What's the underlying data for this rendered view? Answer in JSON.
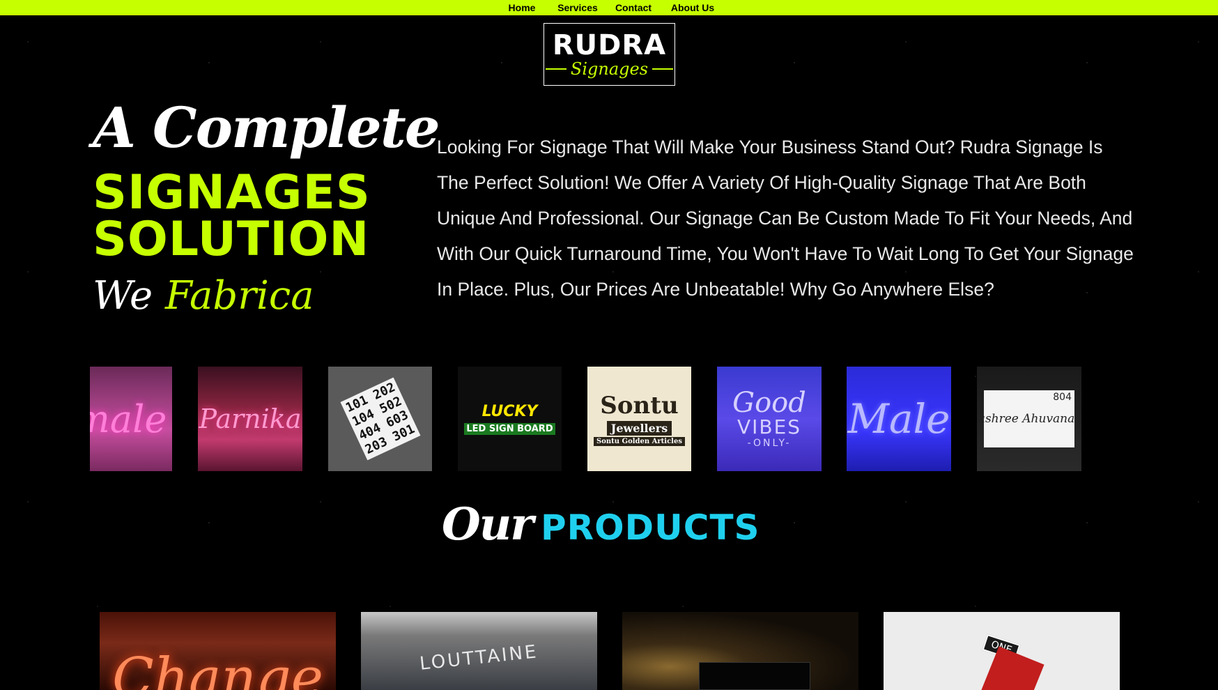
{
  "nav": {
    "home": "Home",
    "services": "Services",
    "contact": "Contact",
    "about": "About Us"
  },
  "logo": {
    "title": "RUDRA",
    "subtitle": "Signages"
  },
  "hero": {
    "line1": "A Complete",
    "line2": "SIGNAGES",
    "line3": "SOLUTION",
    "line4_white": "We",
    "line4_accent": "Fabrica",
    "description": "Looking For Signage That Will Make Your Business Stand Out? Rudra Signage Is The Perfect Solution! We Offer A Variety Of High-Quality Signage That Are Both Unique And Professional. Our Signage Can Be Custom Made To Fit Your Needs, And With Our Quick Turnaround Time, You Won't Have To Wait Long To Get Your Signage In Place. Plus, Our Prices Are Unbeatable! Why Go Anywhere Else?"
  },
  "gallery": {
    "g1": "male",
    "g2": "Parnika",
    "g3": "101 202\n104 502\n404 603\n203 301",
    "g4_main": "LUCKY",
    "g4_sub": "LED SIGN BOARD",
    "g5_main": "Sontu",
    "g5_sub": "Jewellers",
    "g5_sub2": "Sontu Golden Articles",
    "g6_main": "Good",
    "g6_sub": "VIBES",
    "g6_sub2": "-ONLY-",
    "g7": "Male",
    "g8_name": "Anushree Ahuvananda",
    "g8_num": "804"
  },
  "products": {
    "heading_script": "Our",
    "heading_bold": "PRODUCTS",
    "cards": [
      {
        "text": "Change"
      },
      {
        "text": "LOUTTAINE"
      },
      {
        "text": ""
      },
      {
        "text": "ONE"
      }
    ]
  },
  "colors": {
    "accent": "#c6ff00",
    "products_cyan": "#1fd0ee",
    "background": "#000000"
  }
}
